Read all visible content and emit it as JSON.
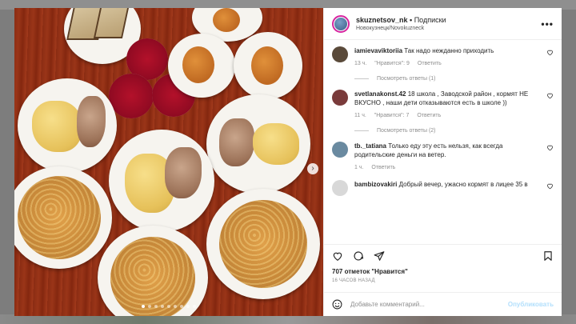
{
  "post": {
    "username": "skuznetsov_nk",
    "separator": " • ",
    "follow": "Подписки",
    "location": "Новокузнецк/Novokuzneck",
    "more_icon": "•••"
  },
  "comments": [
    {
      "user": "iamievaviktoriia",
      "text": "Так надо нежданно приходить",
      "time": "13 ч.",
      "likes": "\"Нравится\": 9",
      "reply": "Ответить",
      "view_replies": "Посмотреть ответы (1)",
      "avatar_color": "#5a4a3a"
    },
    {
      "user": "svetlanakonst.42",
      "text": "18 школа , Заводской район , кормят НЕ ВКУСНО , наши дети отказываются есть в школе ))",
      "time": "11 ч.",
      "likes": "\"Нравится\": 7",
      "reply": "Ответить",
      "view_replies": "Посмотреть ответы (2)",
      "avatar_color": "#7a3b3b"
    },
    {
      "user": "tb._tatiana",
      "text": "Только еду эту есть нельзя, как всегда родительские деньги на ветер.",
      "time": "1 ч.",
      "reply": "Ответить",
      "avatar_color": "#6a8aa0"
    },
    {
      "user": "bambizovakiri",
      "text": "Добрый вечер, ужасно кормят в лицее 35 в",
      "avatar_color": "#d8d8d8"
    }
  ],
  "stats": {
    "likes_count": "707 отметок",
    "likes_word": "\"Нравится\"",
    "posted": "16 ЧАСОВ НАЗАД"
  },
  "compose": {
    "placeholder": "Добавьте комментарий...",
    "publish": "Опубликовать"
  },
  "carousel": {
    "total": 9,
    "active": 0
  },
  "icons": [
    "heart-icon",
    "comment-icon",
    "share-icon",
    "bookmark-icon",
    "emoji-icon",
    "more-icon",
    "next-arrow-icon"
  ]
}
